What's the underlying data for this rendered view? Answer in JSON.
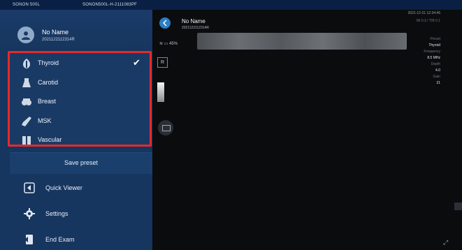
{
  "topbar": {
    "device": "SONON 500L",
    "serial": "SONON500L-H-2111083PF"
  },
  "patient": {
    "name": "No Name",
    "id": "2021122112314R"
  },
  "presets": [
    {
      "label": "Thyroid",
      "icon": "thyroid-icon",
      "selected": true
    },
    {
      "label": "Carotid",
      "icon": "carotid-icon",
      "selected": false
    },
    {
      "label": "Breast",
      "icon": "breast-icon",
      "selected": false
    },
    {
      "label": "MSK",
      "icon": "msk-icon",
      "selected": false
    },
    {
      "label": "Vascular",
      "icon": "vascular-icon",
      "selected": false
    }
  ],
  "save_preset_label": "Save preset",
  "menu": [
    {
      "label": "Quick Viewer",
      "icon": "quick-viewer-icon"
    },
    {
      "label": "Settings",
      "icon": "gear-icon"
    },
    {
      "label": "End Exam",
      "icon": "end-exam-icon"
    }
  ],
  "main": {
    "name": "No Name",
    "id": "2021122112314R",
    "datetime": "2021-12-21 12:34:46",
    "mi_ti": "MI 0.3 / TIB 0.1",
    "battery": "45%",
    "r_label": "R"
  },
  "params": [
    {
      "key": "Preset",
      "value": "Thyroid"
    },
    {
      "key": "Frequency",
      "value": "8.5 MHz"
    },
    {
      "key": "Depth",
      "value": "4.0"
    },
    {
      "key": "Gain",
      "value": "21"
    }
  ],
  "colors": {
    "accent": "#e52a2a",
    "sidebar": "#16355f",
    "topbar": "#0a1f44"
  }
}
